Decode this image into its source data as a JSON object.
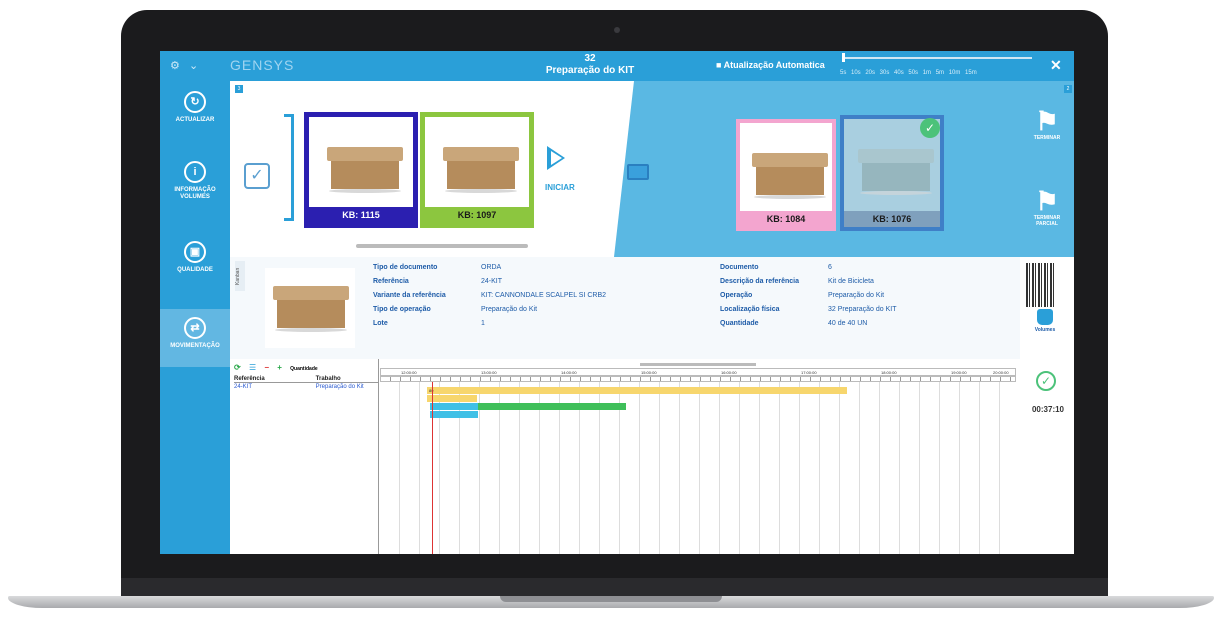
{
  "titlebar": {
    "logo": "GENSYS",
    "order_number": "32",
    "title": "Preparação do KIT",
    "auto_update": "■ Atualização Automatica",
    "intervals": "5s 10s 20s 30s 40s 50s 1m 5m 10m 15m",
    "close": "✕"
  },
  "sidebar": {
    "items": [
      {
        "label": "ACTUALIZAR",
        "icon": "refresh-icon"
      },
      {
        "label": "INFORMAÇÃO VOLUMES",
        "icon": "info-icon"
      },
      {
        "label": "QUALIDADE",
        "icon": "quality-icon"
      },
      {
        "label": "MOVIMENTAÇÃO",
        "icon": "movement-icon"
      }
    ]
  },
  "queue": {
    "badge_left": "3",
    "badge_right": "2",
    "start_label": "INICIAR",
    "pending": [
      {
        "label": "KB: 1115",
        "border": "#2b1fb0"
      },
      {
        "label": "KB: 1097",
        "border": "#8cc63f"
      }
    ],
    "done": [
      {
        "label": "KB: 1084",
        "border": "#f3a5cf"
      },
      {
        "label": "KB: 1076",
        "border": "#3f7fc7"
      }
    ]
  },
  "actions": {
    "terminar": "TERMINAR",
    "terminar_parcial": "TERMINAR PARCIAL",
    "volumes": "Volumes",
    "timer": "00:37:10"
  },
  "detail": {
    "kanban": "Kanban",
    "left_fields": [
      {
        "label": "Tipo de documento",
        "value": "ORDA"
      },
      {
        "label": "Referência",
        "value": "24-KIT"
      },
      {
        "label": "Variante da referência",
        "value": "KIT: CANNONDALE SCALPEL SI CRB2"
      },
      {
        "label": "Tipo de operação",
        "value": "Preparação do Kit"
      },
      {
        "label": "Lote",
        "value": "1"
      }
    ],
    "right_fields": [
      {
        "label": "Documento",
        "value": "6"
      },
      {
        "label": "Descrição da referência",
        "value": "Kit de Bicicleta"
      },
      {
        "label": "Operação",
        "value": "Preparação do Kit"
      },
      {
        "label": "Localização física",
        "value": "32 Preparação do KIT"
      },
      {
        "label": "Quantidade",
        "value": "40 de 40 UN"
      }
    ]
  },
  "grid": {
    "quantity_label": "Quantidade",
    "col_ref": "Referência",
    "col_work": "Trabalho",
    "row_ref": "24-KIT",
    "row_work": "Preparação do Kit"
  },
  "gantt": {
    "hours": [
      "12:00:00",
      "13:00:00",
      "14:00:00",
      "15:00:00",
      "16:00:00",
      "17:00:00",
      "18:00:00",
      "19:00:00",
      "20:00:00"
    ],
    "bar_label": "80"
  },
  "colors": {
    "accent": "#2a9fd8",
    "panel_right": "#5ab8e3",
    "text_blue": "#1e5ca8"
  }
}
